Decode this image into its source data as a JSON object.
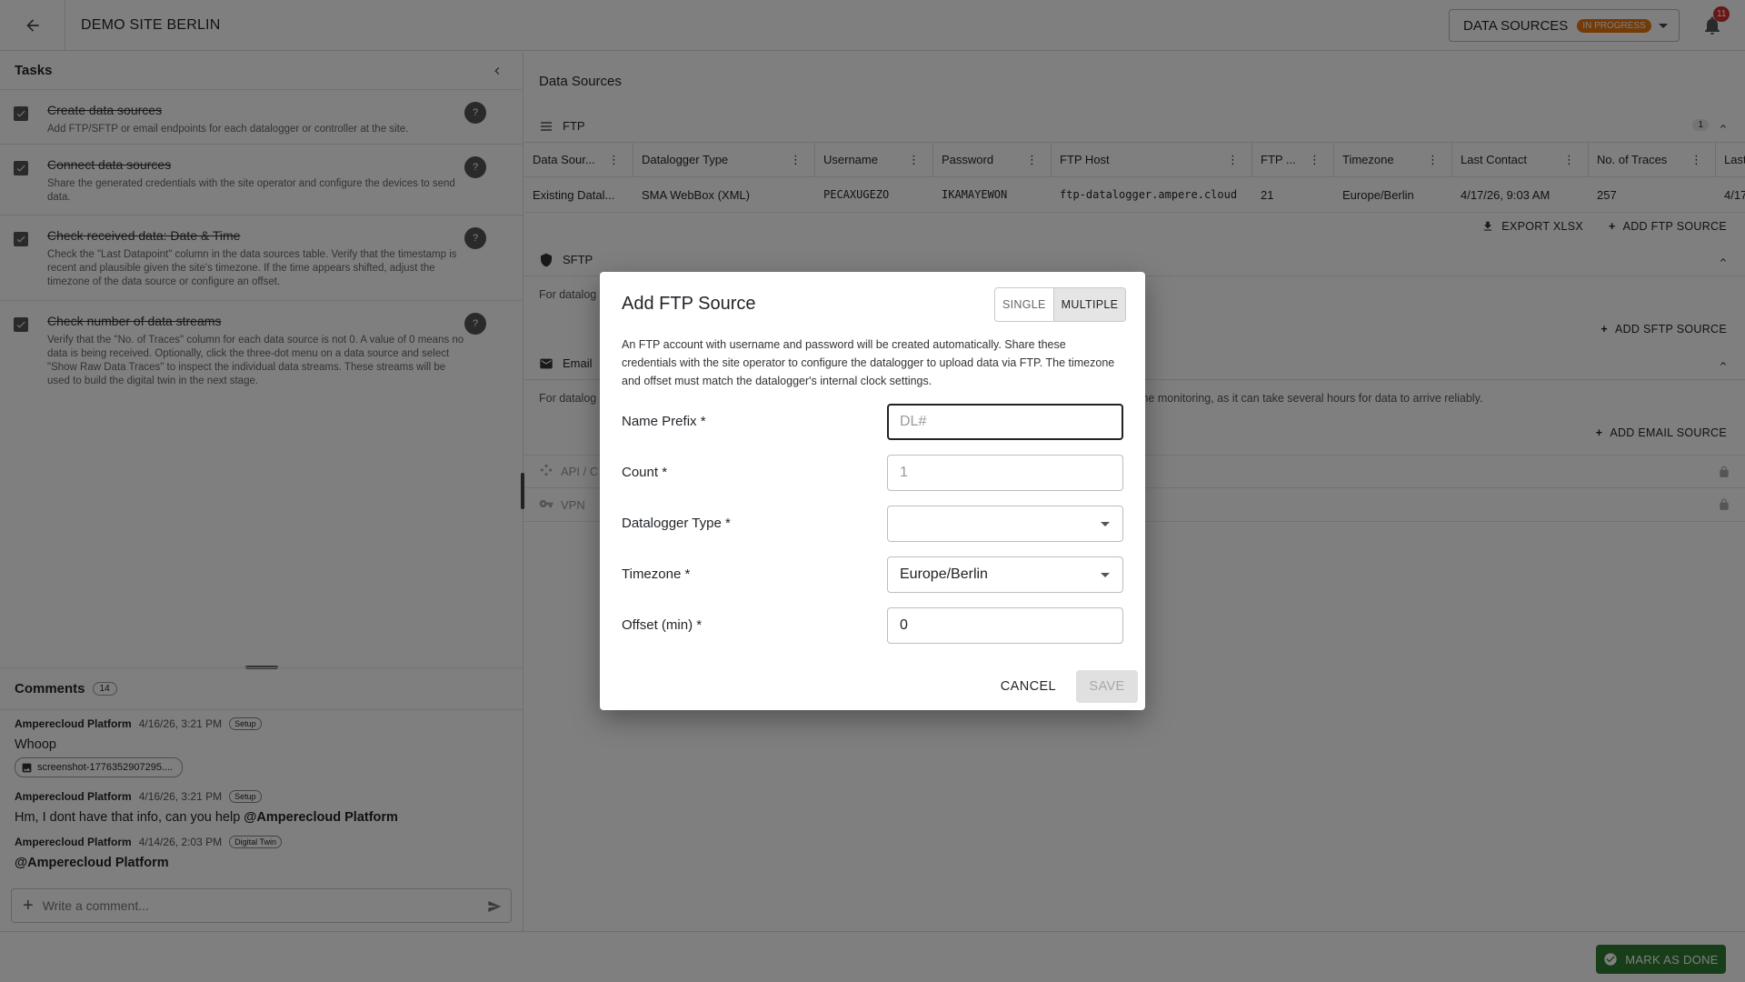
{
  "header": {
    "site_title": "DEMO SITE BERLIN",
    "stage_select": {
      "label": "DATA SOURCES",
      "badge": "IN PROGRESS"
    },
    "notification_count": "11"
  },
  "tasks": {
    "title": "Tasks",
    "items": [
      {
        "title": "Create data sources",
        "description": "Add FTP/SFTP or email endpoints for each datalogger or controller at the site.",
        "done": true
      },
      {
        "title": "Connect data sources",
        "description": "Share the generated credentials with the site operator and configure the devices to send data.",
        "done": true
      },
      {
        "title": "Check received data: Date & Time",
        "description": "Check the \"Last Datapoint\" column in the data sources table. Verify that the timestamp is recent and plausible given the site's timezone. If the time appears shifted, adjust the timezone of the data source or configure an offset.",
        "done": true
      },
      {
        "title": "Check number of data streams",
        "description": "Verify that the \"No. of Traces\" column for each data source is not 0. A value of 0 means no data is being received. Optionally, click the three-dot menu on a data source and select \"Show Raw Data Traces\" to inspect the individual data streams. These streams will be used to build the digital twin in the next stage.",
        "done": true
      }
    ],
    "help_glyph": "?"
  },
  "comments": {
    "title": "Comments",
    "count": "14",
    "items": [
      {
        "author": "Amperecloud Platform",
        "date": "4/16/26, 3:21 PM",
        "tag": "Setup",
        "text": "Whoop",
        "attachment": "screenshot-1776352907295...."
      },
      {
        "author": "Amperecloud Platform",
        "date": "4/16/26, 3:21 PM",
        "tag": "Setup",
        "text": "Hm, I dont have that info, can you help ",
        "mention": "@Amperecloud Platform"
      },
      {
        "author": "Amperecloud Platform",
        "date": "4/14/26, 2:03 PM",
        "tag": "Digital Twin",
        "mention": "@Amperecloud Platform"
      }
    ],
    "input_placeholder": "Write a comment..."
  },
  "data_sources": {
    "title": "Data Sources",
    "ftp": {
      "label": "FTP",
      "count": "1",
      "columns": [
        "Data Sour...",
        "Datalogger Type",
        "Username",
        "Password",
        "FTP Host",
        "FTP ...",
        "Timezone",
        "Last Contact",
        "No. of Traces",
        "Last"
      ],
      "rows": [
        [
          "Existing Datal...",
          "SMA WebBox (XML)",
          "PECAXUGEZO",
          "IKAMAYEWON",
          "ftp-datalogger.ampere.cloud",
          "21",
          "Europe/Berlin",
          "4/17/26, 9:03 AM",
          "257",
          "4/17"
        ]
      ],
      "export_label": "EXPORT XLSX",
      "add_label": "ADD FTP SOURCE"
    },
    "sftp": {
      "label": "SFTP",
      "note": "For datalog",
      "add_label": "ADD SFTP SOURCE"
    },
    "email": {
      "label": "Email",
      "note_start": "For datalog",
      "note_end": "me monitoring, as it can take several hours for data to arrive reliably.",
      "add_label": "ADD EMAIL SOURCE"
    },
    "api_label": "API / C",
    "vpn_label": "VPN"
  },
  "footer": {
    "mark_done_label": "MARK AS DONE"
  },
  "dialog": {
    "title": "Add FTP Source",
    "mode_single": "SINGLE",
    "mode_multiple": "MULTIPLE",
    "mode_selected": "MULTIPLE",
    "description": "An FTP account with username and password will be created automatically. Share these credentials with the site operator to configure the datalogger to upload data via FTP. The timezone and offset must match the datalogger's internal clock settings.",
    "fields": {
      "name_prefix": {
        "label": "Name Prefix *",
        "placeholder": "DL#",
        "value": ""
      },
      "count": {
        "label": "Count *",
        "placeholder": "1",
        "value": ""
      },
      "datalogger_type": {
        "label": "Datalogger Type *",
        "value": ""
      },
      "timezone": {
        "label": "Timezone *",
        "value": "Europe/Berlin"
      },
      "offset": {
        "label": "Offset (min) *",
        "value": "0"
      }
    },
    "cancel_label": "CANCEL",
    "save_label": "SAVE"
  }
}
